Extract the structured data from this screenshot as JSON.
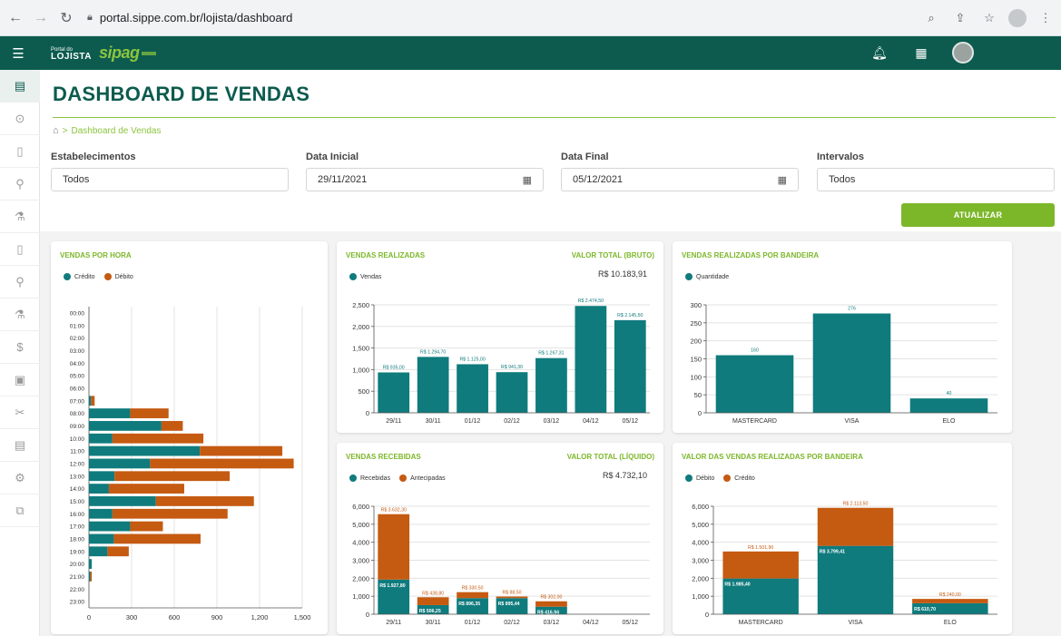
{
  "browser": {
    "url": "portal.sippe.com.br/lojista/dashboard"
  },
  "header": {
    "logo_small": "Portal do",
    "logo_big": "LOJISTA",
    "brand": "sipag",
    "icons": [
      "bell-icon",
      "apps-grid-icon",
      "user-avatar"
    ]
  },
  "sidebar": {
    "items": [
      "store-icon",
      "dollar-icon",
      "phone-icon",
      "link-icon",
      "tool-icon",
      "phone-icon",
      "link-icon",
      "tool-icon",
      "dollar-icon",
      "clipboard-icon",
      "tools-icon",
      "store-icon",
      "settings-icon",
      "layers-icon"
    ]
  },
  "page": {
    "title": "DASHBOARD DE VENDAS",
    "breadcrumb": "Dashboard de Vendas"
  },
  "filters": {
    "estabelecimentos": {
      "label": "Estabelecimentos",
      "value": "Todos"
    },
    "data_inicial": {
      "label": "Data Inicial",
      "value": "29/11/2021"
    },
    "data_final": {
      "label": "Data Final",
      "value": "05/12/2021"
    },
    "intervalos": {
      "label": "Intervalos",
      "value": "Todos"
    },
    "button": "ATUALIZAR"
  },
  "colors": {
    "teal": "#0f7b7d",
    "orange": "#c55a11",
    "green": "#7cb72a",
    "header": "#0c5b4e"
  },
  "cards": {
    "vendas_hora": {
      "title": "VENDAS POR HORA",
      "legend": [
        "Crédito",
        "Débito"
      ]
    },
    "vendas_realizadas": {
      "title": "VENDAS REALIZADAS",
      "sub": "VALOR TOTAL (BRUTO)",
      "total": "R$ 10.183,91",
      "legend": [
        "Vendas"
      ]
    },
    "bandeira": {
      "title": "VENDAS REALIZADAS POR BANDEIRA",
      "legend": [
        "Quantidade"
      ]
    },
    "vendas_recebidas": {
      "title": "VENDAS RECEBIDAS",
      "sub": "VALOR TOTAL (LÍQUIDO)",
      "total": "R$ 4.732,10",
      "legend": [
        "Recebidas",
        "Antecipadas"
      ]
    },
    "valor_bandeira": {
      "title": "VALOR DAS VENDAS REALIZADAS POR BANDEIRA",
      "legend": [
        "Débito",
        "Crédito"
      ]
    }
  },
  "chart_data": [
    {
      "id": "vendas_hora",
      "type": "bar",
      "orientation": "horizontal",
      "stacked": true,
      "categories": [
        "00:00",
        "01:00",
        "02:00",
        "03:00",
        "04:00",
        "05:00",
        "06:00",
        "07:00",
        "08:00",
        "09:00",
        "10:00",
        "11:00",
        "12:00",
        "13:00",
        "14:00",
        "15:00",
        "16:00",
        "17:00",
        "18:00",
        "19:00",
        "20:00",
        "21:00",
        "22:00",
        "23:00"
      ],
      "series": [
        {
          "name": "Crédito",
          "values": [
            0,
            0,
            0,
            0,
            0,
            0,
            0,
            15,
            290,
            510,
            165,
            780,
            430,
            180,
            140,
            470,
            165,
            290,
            175,
            130,
            20,
            10,
            0,
            0
          ]
        },
        {
          "name": "Débito",
          "values": [
            0,
            0,
            0,
            0,
            0,
            0,
            0,
            25,
            270,
            150,
            640,
            580,
            1010,
            810,
            530,
            690,
            810,
            230,
            610,
            150,
            0,
            10,
            0,
            0
          ]
        }
      ],
      "xticks": [
        "0",
        "300",
        "600",
        "900",
        "1,200",
        "1,500"
      ],
      "xlim": [
        0,
        1500
      ]
    },
    {
      "id": "vendas_realizadas",
      "type": "bar",
      "categories": [
        "29/11",
        "30/11",
        "01/12",
        "02/12",
        "03/12",
        "04/12",
        "05/12"
      ],
      "values": [
        935.0,
        1294.7,
        1125.0,
        941.3,
        1267.31,
        2474.5,
        2145.5
      ],
      "data_labels": [
        "R$ 935,00",
        "R$ 1.294,70",
        "R$ 1.125,00",
        "R$ 941,30",
        "R$ 1.267,31",
        "R$ 2.474,50",
        "R$ 2.145,50"
      ],
      "yticks": [
        "0",
        "500",
        "1,000",
        "1,500",
        "2,000",
        "2,500"
      ],
      "ylim": [
        0,
        2500
      ]
    },
    {
      "id": "bandeira",
      "type": "bar",
      "categories": [
        "MASTERCARD",
        "VISA",
        "ELO"
      ],
      "values": [
        160,
        276,
        40
      ],
      "data_labels": [
        "160",
        "276",
        "40"
      ],
      "yticks": [
        "0",
        "50",
        "100",
        "150",
        "200",
        "250",
        "300"
      ],
      "ylim": [
        0,
        300
      ]
    },
    {
      "id": "vendas_recebidas",
      "type": "bar",
      "stacked": true,
      "categories": [
        "29/11",
        "30/11",
        "01/12",
        "02/12",
        "03/12",
        "04/12",
        "05/12"
      ],
      "series": [
        {
          "name": "Recebidas",
          "values": [
            1927.8,
            506.25,
            896.35,
            895.44,
            416.94,
            0,
            0
          ],
          "labels": [
            "R$ 1.927,80",
            "R$ 506,25",
            "R$ 896,35",
            "R$ 895,44",
            "R$ 416,94",
            "",
            ""
          ]
        },
        {
          "name": "Antecipadas",
          "values": [
            3632.3,
            438.8,
            330.5,
            88.5,
            302.0,
            0,
            0
          ],
          "labels": [
            "R$ 3.632,30",
            "R$ 438,80",
            "R$ 330,50",
            "R$ 88,50",
            "R$ 302,00",
            "",
            ""
          ]
        }
      ],
      "yticks": [
        "0",
        "1,000",
        "2,000",
        "3,000",
        "4,000",
        "5,000",
        "6,000"
      ],
      "ylim": [
        0,
        6000
      ]
    },
    {
      "id": "valor_bandeira",
      "type": "bar",
      "stacked": true,
      "categories": [
        "MASTERCARD",
        "VISA",
        "ELO"
      ],
      "series": [
        {
          "name": "Débito",
          "values": [
            1985.4,
            3799.41,
            610.7
          ],
          "labels": [
            "R$ 1.985,40",
            "R$ 3.799,41",
            "R$ 610,70"
          ]
        },
        {
          "name": "Crédito",
          "values": [
            1501.9,
            2113.5,
            240.0
          ],
          "labels": [
            "R$ 1.501,90",
            "R$ 2.113,50",
            "R$ 240,00"
          ]
        }
      ],
      "yticks": [
        "0",
        "1,000",
        "2,000",
        "3,000",
        "4,000",
        "5,000",
        "6,000"
      ],
      "ylim": [
        0,
        6000
      ]
    }
  ]
}
